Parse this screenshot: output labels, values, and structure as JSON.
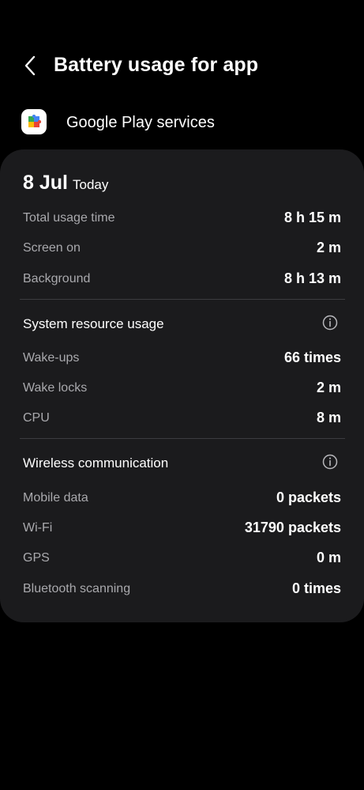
{
  "header": {
    "title": "Battery usage for app",
    "back_icon": "back-arrow-icon"
  },
  "app": {
    "name": "Google Play services",
    "icon": "google-play-services-icon"
  },
  "summary": {
    "date": "8 Jul",
    "date_label": "Today",
    "rows": [
      {
        "label": "Total usage time",
        "value": "8 h 15 m"
      },
      {
        "label": "Screen on",
        "value": "2 m"
      },
      {
        "label": "Background",
        "value": "8 h 13 m"
      }
    ]
  },
  "system_resource": {
    "title": "System resource usage",
    "info_icon": "info-icon",
    "rows": [
      {
        "label": "Wake-ups",
        "value": "66 times"
      },
      {
        "label": "Wake locks",
        "value": "2 m"
      },
      {
        "label": "CPU",
        "value": "8 m"
      }
    ]
  },
  "wireless": {
    "title": "Wireless communication",
    "info_icon": "info-icon",
    "rows": [
      {
        "label": "Mobile data",
        "value": "0 packets"
      },
      {
        "label": "Wi-Fi",
        "value": "31790 packets"
      },
      {
        "label": "GPS",
        "value": "0 m"
      },
      {
        "label": "Bluetooth scanning",
        "value": "0 times"
      }
    ]
  },
  "colors": {
    "background": "#000000",
    "card": "#1b1b1d",
    "label_text": "#a9a9ad",
    "value_text": "#ffffff",
    "divider": "#3c3c40"
  }
}
